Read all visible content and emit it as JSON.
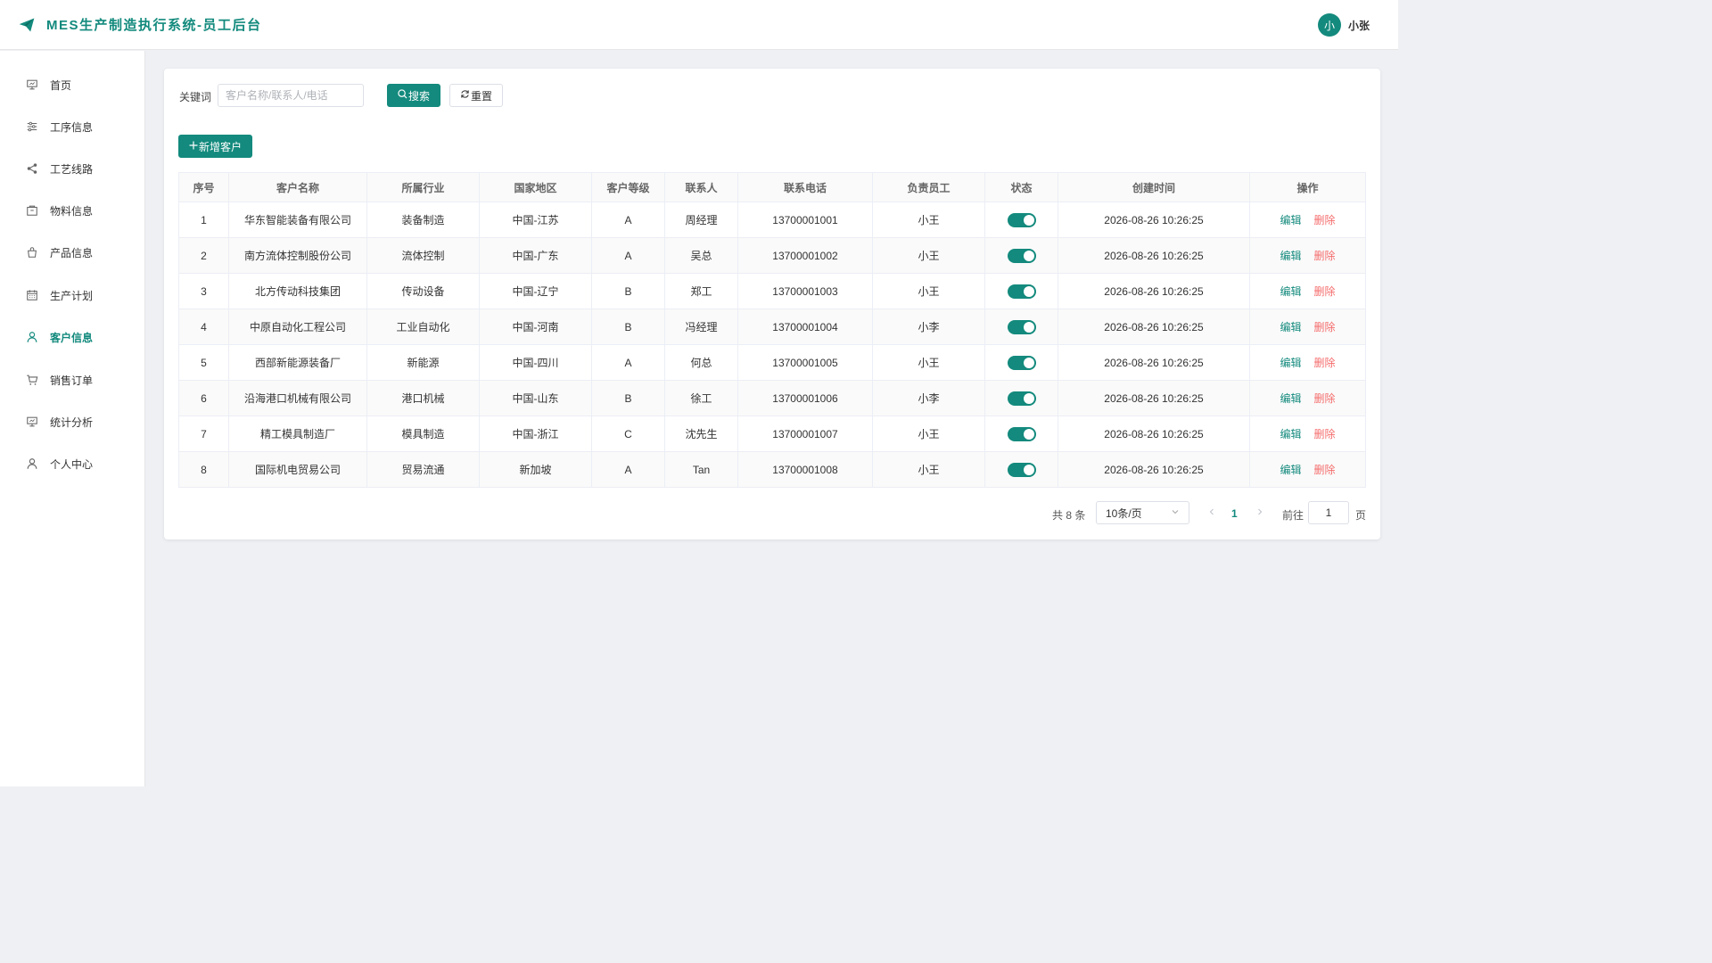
{
  "header": {
    "title": "MES生产制造执行系统-员工后台",
    "avatar_text": "小",
    "user_name": "小张"
  },
  "sidebar": {
    "items": [
      {
        "label": "首页",
        "icon": "monitor-icon"
      },
      {
        "label": "工序信息",
        "icon": "sliders-icon"
      },
      {
        "label": "工艺线路",
        "icon": "share-icon"
      },
      {
        "label": "物料信息",
        "icon": "box-icon"
      },
      {
        "label": "产品信息",
        "icon": "bag-icon"
      },
      {
        "label": "生产计划",
        "icon": "calendar-icon"
      },
      {
        "label": "客户信息",
        "icon": "user-icon",
        "active": true
      },
      {
        "label": "销售订单",
        "icon": "cart-icon"
      },
      {
        "label": "统计分析",
        "icon": "monitor-icon"
      },
      {
        "label": "个人中心",
        "icon": "user-icon"
      }
    ]
  },
  "search": {
    "label": "关键词",
    "placeholder": "客户名称/联系人/电话",
    "value": "",
    "search_label": "搜索",
    "reset_label": "重置"
  },
  "add_button_label": "新增客户",
  "table": {
    "columns": [
      "序号",
      "客户名称",
      "所属行业",
      "国家地区",
      "客户等级",
      "联系人",
      "联系电话",
      "负责员工",
      "状态",
      "创建时间",
      "操作"
    ],
    "rows": [
      {
        "no": "1",
        "name": "华东智能装备有限公司",
        "industry": "装备制造",
        "region": "中国-江苏",
        "level": "A",
        "contact": "周经理",
        "phone": "13700001001",
        "staff": "小王",
        "enabled": true,
        "created": "2026-08-26 10:26:25"
      },
      {
        "no": "2",
        "name": "南方流体控制股份公司",
        "industry": "流体控制",
        "region": "中国-广东",
        "level": "A",
        "contact": "吴总",
        "phone": "13700001002",
        "staff": "小王",
        "enabled": true,
        "created": "2026-08-26 10:26:25"
      },
      {
        "no": "3",
        "name": "北方传动科技集团",
        "industry": "传动设备",
        "region": "中国-辽宁",
        "level": "B",
        "contact": "郑工",
        "phone": "13700001003",
        "staff": "小王",
        "enabled": true,
        "created": "2026-08-26 10:26:25"
      },
      {
        "no": "4",
        "name": "中原自动化工程公司",
        "industry": "工业自动化",
        "region": "中国-河南",
        "level": "B",
        "contact": "冯经理",
        "phone": "13700001004",
        "staff": "小李",
        "enabled": true,
        "created": "2026-08-26 10:26:25"
      },
      {
        "no": "5",
        "name": "西部新能源装备厂",
        "industry": "新能源",
        "region": "中国-四川",
        "level": "A",
        "contact": "何总",
        "phone": "13700001005",
        "staff": "小王",
        "enabled": true,
        "created": "2026-08-26 10:26:25"
      },
      {
        "no": "6",
        "name": "沿海港口机械有限公司",
        "industry": "港口机械",
        "region": "中国-山东",
        "level": "B",
        "contact": "徐工",
        "phone": "13700001006",
        "staff": "小李",
        "enabled": true,
        "created": "2026-08-26 10:26:25"
      },
      {
        "no": "7",
        "name": "精工模具制造厂",
        "industry": "模具制造",
        "region": "中国-浙江",
        "level": "C",
        "contact": "沈先生",
        "phone": "13700001007",
        "staff": "小王",
        "enabled": true,
        "created": "2026-08-26 10:26:25"
      },
      {
        "no": "8",
        "name": "国际机电贸易公司",
        "industry": "贸易流通",
        "region": "新加坡",
        "level": "A",
        "contact": "Tan",
        "phone": "13700001008",
        "staff": "小王",
        "enabled": true,
        "created": "2026-08-26 10:26:25"
      }
    ],
    "edit_label": "编辑",
    "delete_label": "删除"
  },
  "pagination": {
    "total_text": "共 8 条",
    "page_size": "10条/页",
    "current_page": "1",
    "goto_label": "前往",
    "goto_value": "1",
    "page_unit": "页"
  },
  "colors": {
    "accent": "#138a7d",
    "danger": "#f56c6c",
    "background": "#eef0f4"
  }
}
